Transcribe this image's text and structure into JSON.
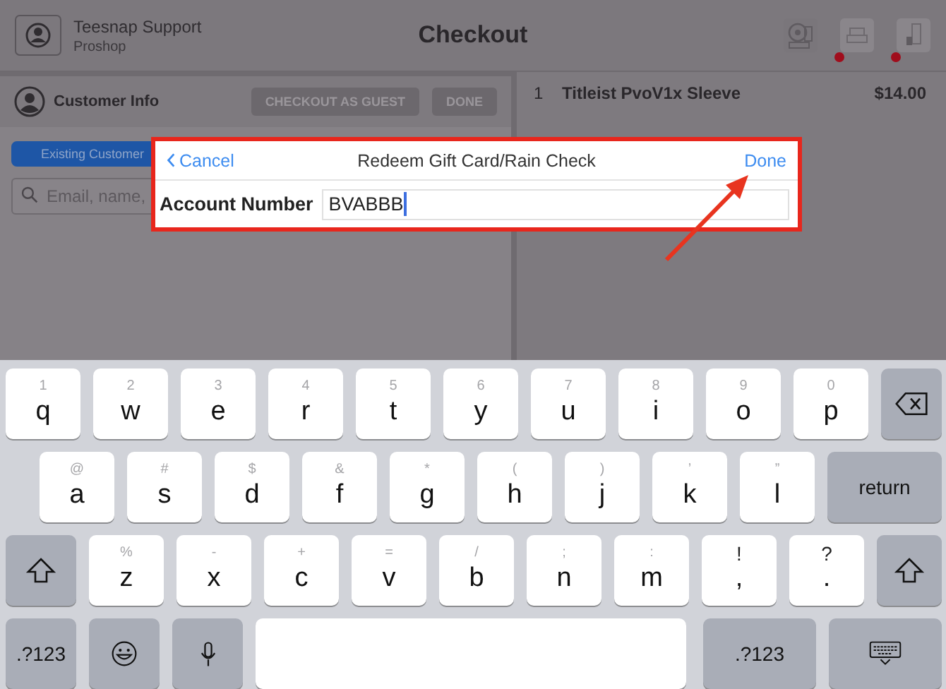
{
  "header": {
    "user_name": "Teesnap Support",
    "user_role": "Proshop",
    "title": "Checkout",
    "devices": [
      {
        "kind": "scanner",
        "alert": false
      },
      {
        "kind": "printer",
        "alert": true
      },
      {
        "kind": "drawer",
        "alert": true
      }
    ]
  },
  "customer_panel": {
    "title": "Customer Info",
    "buttons": [
      "CHECKOUT AS GUEST",
      "DONE"
    ],
    "tabs": [
      {
        "label": "Existing Customer",
        "selected": true
      }
    ],
    "search": {
      "placeholder": "Email, name,"
    }
  },
  "cart": {
    "items": [
      {
        "quantity": "1",
        "name": "Titleist PvoV1x Sleeve",
        "price": "$14.00"
      }
    ]
  },
  "dialog": {
    "cancel": "Cancel",
    "title": "Redeem Gift Card/Rain Check",
    "done": "Done",
    "field_label": "Account Number",
    "value": "BVABBB",
    "highlighted": true
  },
  "keyboard": {
    "rows": [
      {
        "keys": [
          {
            "kind": "letter",
            "main": "q",
            "alt": "1"
          },
          {
            "kind": "letter",
            "main": "w",
            "alt": "2"
          },
          {
            "kind": "letter",
            "main": "e",
            "alt": "3"
          },
          {
            "kind": "letter",
            "main": "r",
            "alt": "4"
          },
          {
            "kind": "letter",
            "main": "t",
            "alt": "5"
          },
          {
            "kind": "letter",
            "main": "y",
            "alt": "6"
          },
          {
            "kind": "letter",
            "main": "u",
            "alt": "7"
          },
          {
            "kind": "letter",
            "main": "i",
            "alt": "8"
          },
          {
            "kind": "letter",
            "main": "o",
            "alt": "9"
          },
          {
            "kind": "letter",
            "main": "p",
            "alt": "0"
          },
          {
            "kind": "backspace"
          }
        ]
      },
      {
        "keys": [
          {
            "kind": "letter",
            "main": "a",
            "alt": "@"
          },
          {
            "kind": "letter",
            "main": "s",
            "alt": "#"
          },
          {
            "kind": "letter",
            "main": "d",
            "alt": "$"
          },
          {
            "kind": "letter",
            "main": "f",
            "alt": "&"
          },
          {
            "kind": "letter",
            "main": "g",
            "alt": "*"
          },
          {
            "kind": "letter",
            "main": "h",
            "alt": "("
          },
          {
            "kind": "letter",
            "main": "j",
            "alt": ")"
          },
          {
            "kind": "letter",
            "main": "k",
            "alt": "’"
          },
          {
            "kind": "letter",
            "main": "l",
            "alt": "”"
          },
          {
            "kind": "return",
            "main": "return"
          }
        ]
      },
      {
        "keys": [
          {
            "kind": "shift"
          },
          {
            "kind": "letter",
            "main": "z",
            "alt": "%"
          },
          {
            "kind": "letter",
            "main": "x",
            "alt": "-"
          },
          {
            "kind": "letter",
            "main": "c",
            "alt": "+"
          },
          {
            "kind": "letter",
            "main": "v",
            "alt": "="
          },
          {
            "kind": "letter",
            "main": "b",
            "alt": "/"
          },
          {
            "kind": "letter",
            "main": "n",
            "alt": ";"
          },
          {
            "kind": "letter",
            "main": "m",
            "alt": ":"
          },
          {
            "kind": "punct",
            "main": ",",
            "alt": "!"
          },
          {
            "kind": "punct",
            "main": ".",
            "alt": "?"
          },
          {
            "kind": "shift"
          }
        ]
      },
      {
        "keys": [
          {
            "kind": "mode",
            "main": ".?123"
          },
          {
            "kind": "emoji"
          },
          {
            "kind": "mic"
          },
          {
            "kind": "space"
          },
          {
            "kind": "mode",
            "main": ".?123"
          },
          {
            "kind": "hide"
          }
        ]
      }
    ]
  }
}
